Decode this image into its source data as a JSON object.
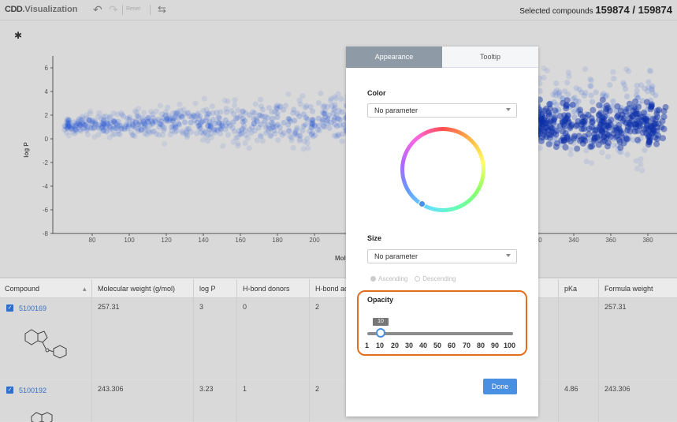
{
  "app": {
    "logo_main": "CDD",
    "logo_sub": "Visualization",
    "reset_label": "Reset",
    "selected_label": "Selected compounds",
    "selected_count": "159874 / 159874"
  },
  "plot": {
    "ylabel": "log P",
    "xlabel_partial": "Mol",
    "y_ticks": [
      "6",
      "4",
      "2",
      "0",
      "-2",
      "-4",
      "-6",
      "-8"
    ],
    "x_ticks_left": [
      "80",
      "100",
      "120",
      "140",
      "160",
      "180",
      "200"
    ],
    "x_ticks_right": [
      "320",
      "340",
      "360",
      "380"
    ]
  },
  "chart_data": {
    "type": "scatter",
    "xlabel": "Mol",
    "ylabel": "log P",
    "x_ticks": [
      80,
      100,
      120,
      140,
      160,
      180,
      200,
      320,
      340,
      360,
      380
    ],
    "y_ticks": [
      6,
      4,
      2,
      0,
      -2,
      -4,
      -6,
      -8
    ],
    "ylim": [
      -8,
      7
    ],
    "color": "#1a4fd6"
  },
  "table": {
    "columns": [
      "Compound",
      "Molecular weight (g/mol)",
      "log P",
      "H-bond donors",
      "H-bond ac",
      "pKa",
      "Formula weight"
    ],
    "rows": [
      {
        "id": "5100169",
        "mw": "257.31",
        "logp": "3",
        "hbd": "0",
        "hba": "2",
        "pka": "",
        "fw": "257.31"
      },
      {
        "id": "5100192",
        "mw": "243.306",
        "logp": "3.23",
        "hbd": "1",
        "hba": "2",
        "pka": "4.86",
        "fw": "243.306"
      }
    ]
  },
  "modal": {
    "tab_appearance": "Appearance",
    "tab_tooltip": "Tooltip",
    "color_title": "Color",
    "color_select": "No parameter",
    "size_title": "Size",
    "size_select": "No parameter",
    "ascending": "Ascending",
    "descending": "Descending",
    "opacity_title": "Opacity",
    "opacity_value": "10",
    "opacity_ticks": [
      "1",
      "10",
      "20",
      "30",
      "40",
      "50",
      "60",
      "70",
      "80",
      "90",
      "100"
    ],
    "done_label": "Done",
    "accent": "#4a90e2",
    "highlight": "#e07020"
  }
}
